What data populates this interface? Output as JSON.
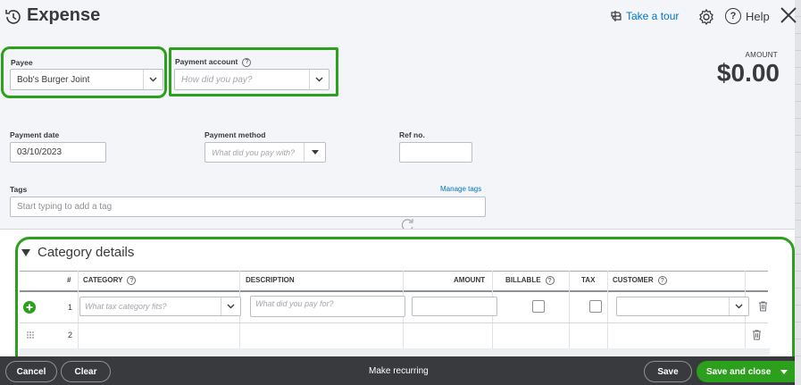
{
  "header": {
    "title": "Expense",
    "take_tour": "Take a tour",
    "help": "Help"
  },
  "payee": {
    "label": "Payee",
    "value": "Bob's Burger Joint"
  },
  "payment_account": {
    "label": "Payment account",
    "placeholder": "How did you pay?"
  },
  "amount": {
    "label": "AMOUNT",
    "value": "$0.00"
  },
  "payment_date": {
    "label": "Payment date",
    "value": "03/10/2023"
  },
  "payment_method": {
    "label": "Payment method",
    "placeholder": "What did you pay with?"
  },
  "ref_no": {
    "label": "Ref no.",
    "value": ""
  },
  "tags": {
    "label": "Tags",
    "placeholder": "Start typing to add a tag",
    "manage": "Manage tags"
  },
  "category_details": {
    "title": "Category details",
    "columns": [
      "#",
      "CATEGORY",
      "DESCRIPTION",
      "AMOUNT",
      "BILLABLE",
      "TAX",
      "CUSTOMER"
    ],
    "rows": [
      {
        "num": "1",
        "category_placeholder": "What tax category fits?",
        "description_placeholder": "What did you pay for?"
      },
      {
        "num": "2"
      }
    ]
  },
  "footer": {
    "cancel": "Cancel",
    "clear": "Clear",
    "make_recurring": "Make recurring",
    "save": "Save",
    "save_and_close": "Save and close"
  },
  "colors": {
    "accent_green": "#2ca01c",
    "link_blue": "#0077c5",
    "footer_bg": "#393a3d"
  }
}
